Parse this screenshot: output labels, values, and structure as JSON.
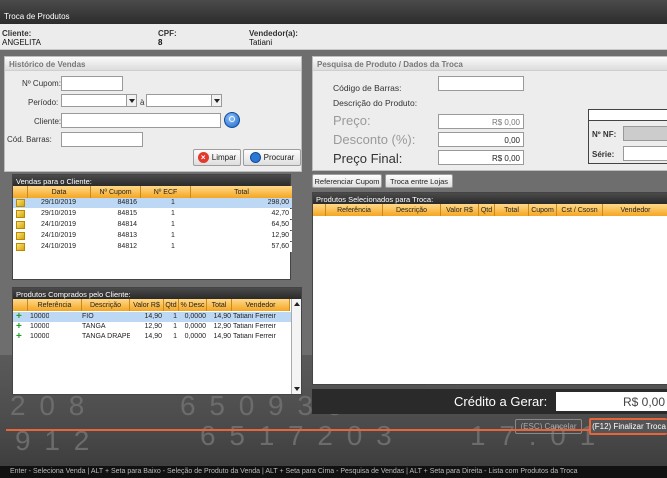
{
  "window": {
    "title": "Troca de Produtos"
  },
  "info": {
    "cliente_label": "Cliente:",
    "cliente_value": "ANGELITA",
    "cpf_label": "CPF:",
    "cpf_value": "8",
    "vendedor_label": "Vendedor(a):",
    "vendedor_value": "Tatiani"
  },
  "historico": {
    "title": "Histórico de Vendas",
    "cupom_label": "Nº Cupom:",
    "periodo_label": "Período:",
    "a_label": "à",
    "cliente_label": "Cliente:",
    "cod_barras_label": "Cód. Barras:",
    "limpar": "Limpar",
    "procurar": "Procurar"
  },
  "vendas": {
    "title": "Vendas para o Cliente:",
    "columns": [
      "Data",
      "Nº Cupom",
      "Nº ECF",
      "Total"
    ],
    "rows": [
      {
        "data": "29/10/2019",
        "cupom": "84816",
        "ecf": "1",
        "total": "298,00"
      },
      {
        "data": "29/10/2019",
        "cupom": "84815",
        "ecf": "1",
        "total": "42,70"
      },
      {
        "data": "24/10/2019",
        "cupom": "84814",
        "ecf": "1",
        "total": "64,50"
      },
      {
        "data": "24/10/2019",
        "cupom": "84813",
        "ecf": "1",
        "total": "12,90"
      },
      {
        "data": "24/10/2019",
        "cupom": "84812",
        "ecf": "1",
        "total": "57,60"
      }
    ]
  },
  "comprados": {
    "title": "Produtos Comprados pelo Cliente:",
    "columns": [
      "Referência",
      "Descrição",
      "Valor R$",
      "Qtd",
      "% Desc",
      "Total",
      "Vendedor"
    ],
    "rows": [
      {
        "ref": "10000",
        "desc": "FIO",
        "valor": "14,90",
        "qtd": "1",
        "pdesc": "0,0000",
        "total": "14,90",
        "vend": "Tatiani Ferreir"
      },
      {
        "ref": "10000",
        "desc": "TANGA",
        "valor": "12,90",
        "qtd": "1",
        "pdesc": "0,0000",
        "total": "12,90",
        "vend": "Tatiani Ferreir"
      },
      {
        "ref": "10000",
        "desc": "TANGA DRAPE",
        "valor": "14,90",
        "qtd": "1",
        "pdesc": "0,0000",
        "total": "14,90",
        "vend": "Tatiani Ferreir"
      }
    ]
  },
  "pesquisa": {
    "title": "Pesquisa de Produto / Dados da Troca",
    "codigo_label": "Código de Barras:",
    "descricao_label": "Descrição do Produto:",
    "preco_label": "Preço:",
    "preco_value": "R$ 0,00",
    "desconto_label": "Desconto (%):",
    "desconto_value": "0,00",
    "preco_final_label": "Preço Final:",
    "preco_final_value": "R$ 0,00",
    "nf_label": "Nº NF:",
    "serie_label": "Série:"
  },
  "troca": {
    "referenciar": "Referenciar Cupom",
    "entre_lojas": "Troca entre Lojas",
    "title": "Produtos Selecionados para Troca:",
    "columns": [
      "Referência",
      "Descrição",
      "Valor R$",
      "Qtd",
      "Total",
      "Cupom",
      "Cst / Csosn",
      "Vendedor"
    ]
  },
  "credito": {
    "label": "Crédito a Gerar:",
    "value": "R$ 0,00"
  },
  "footer": {
    "cancelar": "(ESC) Cancelar",
    "finalizar": "(F12) Finalizar Troca",
    "status": "Enter - Seleciona Venda | ALT + Seta para Baixo - Seleção de Produto da Venda | ALT + Seta para Cima - Pesquisa de Vendas | ALT + Seta para Direita - Lista com Produtos da Troca"
  },
  "colors": {
    "accent": "#e8643b",
    "header": "#f4a622",
    "selected": "#bcd8f5"
  }
}
